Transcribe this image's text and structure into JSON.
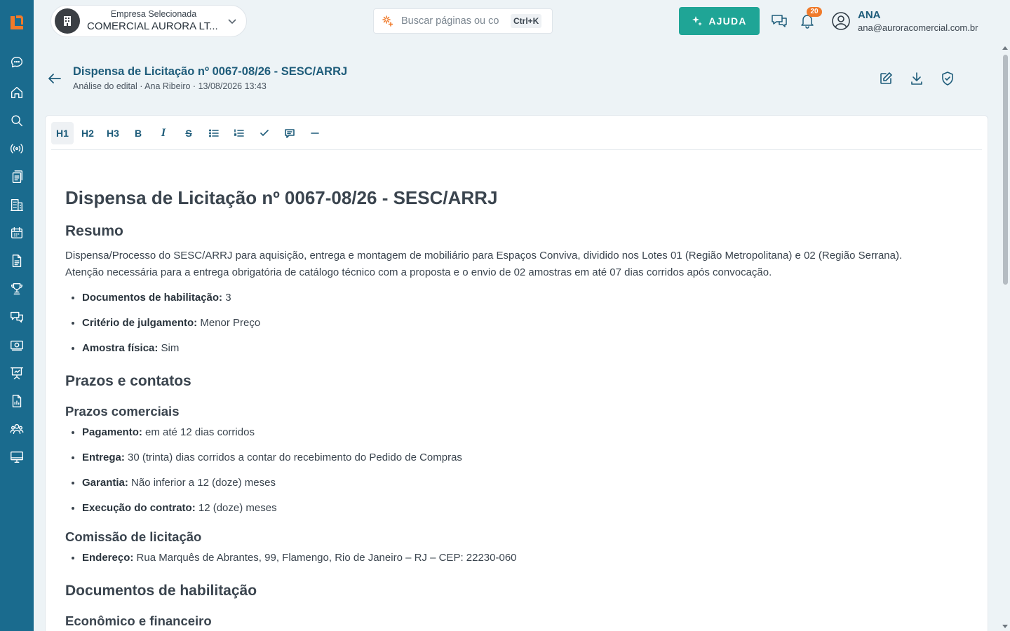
{
  "sidebar": {
    "items": [
      {
        "name": "sidebar-item-chat",
        "icon": "chat-bubble-icon"
      },
      {
        "name": "sidebar-item-home",
        "icon": "home-icon"
      },
      {
        "name": "sidebar-item-search",
        "icon": "search-icon"
      },
      {
        "name": "sidebar-item-broadcast",
        "icon": "broadcast-icon"
      },
      {
        "name": "sidebar-item-documents",
        "icon": "documents-icon"
      },
      {
        "name": "sidebar-item-companies",
        "icon": "building-icon"
      },
      {
        "name": "sidebar-item-calendar",
        "icon": "calendar-icon"
      },
      {
        "name": "sidebar-item-file",
        "icon": "file-icon"
      },
      {
        "name": "sidebar-item-trophy",
        "icon": "trophy-icon"
      },
      {
        "name": "sidebar-item-messages",
        "icon": "messages-icon"
      },
      {
        "name": "sidebar-item-money",
        "icon": "money-icon"
      },
      {
        "name": "sidebar-item-presentation",
        "icon": "presentation-icon"
      },
      {
        "name": "sidebar-item-report",
        "icon": "report-icon"
      },
      {
        "name": "sidebar-item-users",
        "icon": "users-icon"
      },
      {
        "name": "sidebar-item-monitor",
        "icon": "monitor-icon"
      }
    ]
  },
  "header": {
    "company_label": "Empresa Selecionada",
    "company_name": "COMERCIAL AURORA LT...",
    "search_placeholder": "Buscar páginas ou co",
    "search_shortcut": "Ctrl+K",
    "help_label": "AJUDA",
    "notifications_count": "20",
    "user_name": "ANA",
    "user_email": "ana@auroracomercial.com.br"
  },
  "document": {
    "title": "Dispensa de Licitação nº 0067-08/26 - SESC/ARRJ",
    "meta": "Análise do edital · Ana Ribeiro · 13/08/2026 13:43"
  },
  "toolbar": {
    "h1": "H1",
    "h2": "H2",
    "h3": "H3",
    "bold": "B",
    "italic": "I",
    "strike": "S"
  },
  "content": {
    "title": "Dispensa de Licitação nº 0067-08/26 - SESC/ARRJ",
    "resumo_heading": "Resumo",
    "resumo_p1": "Dispensa/Processo do SESC/ARRJ para aquisição, entrega e montagem de mobiliário para Espaços Conviva, dividido nos Lotes 01 (Região Metropolitana) e 02 (Região Serrana).",
    "resumo_p2": "Atenção necessária para a entrega obrigatória de catálogo técnico com a proposta e o envio de 02 amostras em até 07 dias corridos após convocação.",
    "resumo_items": [
      {
        "label": "Documentos de habilitação:",
        "value": " 3"
      },
      {
        "label": "Critério de julgamento:",
        "value": " Menor Preço"
      },
      {
        "label": "Amostra física:",
        "value": " Sim"
      }
    ],
    "prazos_heading": "Prazos e contatos",
    "prazos_comerciais_heading": "Prazos comerciais",
    "prazos_items": [
      {
        "label": "Pagamento:",
        "value": " em até 12 dias corridos"
      },
      {
        "label": "Entrega:",
        "value": " 30 (trinta) dias corridos a contar do recebimento do Pedido de Compras"
      },
      {
        "label": "Garantia:",
        "value": " Não inferior a 12 (doze) meses"
      },
      {
        "label": "Execução do contrato:",
        "value": " 12 (doze) meses"
      }
    ],
    "comissao_heading": "Comissão de licitação",
    "comissao_items": [
      {
        "label": "Endereço:",
        "value": " Rua Marquês de Abrantes, 99, Flamengo, Rio de Janeiro – RJ – CEP: 22230-060"
      }
    ],
    "habilitacao_heading": "Documentos de habilitação",
    "economico_heading": "Econômico e financeiro"
  },
  "colors": {
    "sidebar": "#1a6b8e",
    "accent": "#1fa596",
    "brand_text": "#1e5c7a",
    "badge": "#f07a2a",
    "logo": "#f07a2a"
  }
}
